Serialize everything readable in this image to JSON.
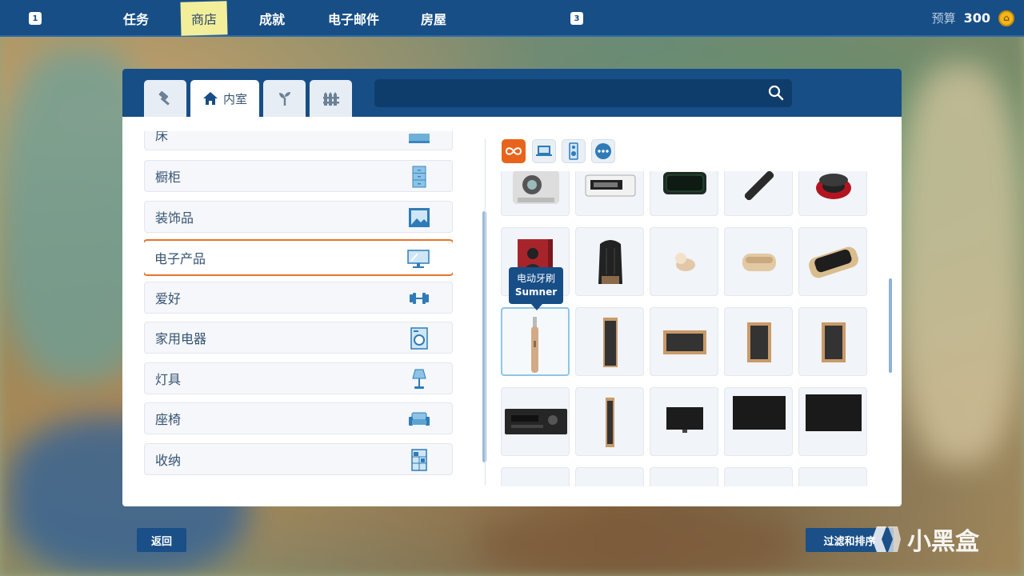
{
  "topbar": {
    "key_left": "1",
    "key_right": "3",
    "tabs": [
      "任务",
      "商店",
      "成就",
      "电子邮件",
      "房屋"
    ],
    "active_tab": "商店",
    "budget_label": "预算",
    "budget_value": "300"
  },
  "panel": {
    "tabs": [
      {
        "icon": "hammer-icon",
        "label": ""
      },
      {
        "icon": "house-icon",
        "label": "内室"
      },
      {
        "icon": "plant-icon",
        "label": ""
      },
      {
        "icon": "fence-icon",
        "label": ""
      }
    ],
    "search": {
      "value": "",
      "placeholder": ""
    },
    "categories": [
      {
        "label": "床",
        "icon": "bed-icon"
      },
      {
        "label": "橱柜",
        "icon": "cabinet-icon"
      },
      {
        "label": "装饰品",
        "icon": "picture-icon"
      },
      {
        "label": "电子产品",
        "icon": "monitor-icon",
        "selected": true
      },
      {
        "label": "爱好",
        "icon": "dumbbell-icon"
      },
      {
        "label": "家用电器",
        "icon": "washer-icon"
      },
      {
        "label": "灯具",
        "icon": "lamp-icon"
      },
      {
        "label": "座椅",
        "icon": "sofa-icon"
      },
      {
        "label": "收纳",
        "icon": "shelf-icon"
      }
    ],
    "filters": [
      "infinity-icon",
      "laptop-icon",
      "speaker-icon",
      "more-icon"
    ],
    "tooltip": {
      "name": "电动牙刷",
      "brand": "Sumner"
    }
  },
  "buttons": {
    "back": "返回",
    "filter_sort": "过滤和排序"
  },
  "watermark": {
    "text": "小黑盒"
  },
  "colors": {
    "brand": "#174e86",
    "accent": "#e8641c",
    "coin": "#f2b71b"
  }
}
